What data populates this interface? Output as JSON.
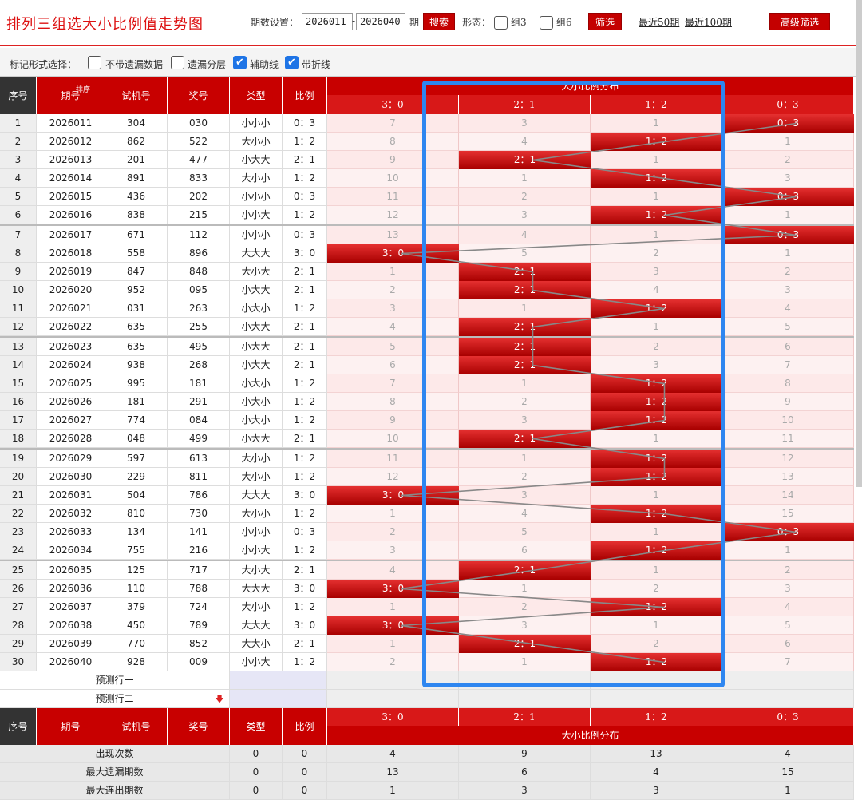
{
  "title": "排列三组选大小比例值走势图",
  "period_setting_label": "期数设置：",
  "period_from": "2026011",
  "period_to": "2026040",
  "period_suffix": "期",
  "search_label": "搜索",
  "shape_label": "形态：",
  "group3_label": "组3",
  "group6_label": "组6",
  "filter_label": "筛选",
  "recent50_label": "最近50期",
  "recent100_label": "最近100期",
  "advanced_filter_label": "高级筛选",
  "mark_label": "标记形式选择：",
  "mark_options": [
    {
      "label": "不带遗漏数据",
      "checked": false
    },
    {
      "label": "遗漏分层",
      "checked": false
    },
    {
      "label": "辅助线",
      "checked": true
    },
    {
      "label": "带折线",
      "checked": true
    }
  ],
  "columns": {
    "seq": "序号",
    "period": "期号",
    "sort_label": "排序",
    "test": "试机号",
    "draw": "奖号",
    "type": "类型",
    "ratio": "比例",
    "dist_title": "大小比例分布",
    "dist": [
      "3：0",
      "2：1",
      "1：2",
      "0：3"
    ]
  },
  "rows": [
    {
      "seq": "1",
      "period": "2026011",
      "test": "304",
      "draw": "030",
      "type": "小小小",
      "ratio": "0：3",
      "hit": 3,
      "miss": [
        "7",
        "3",
        "1",
        ""
      ]
    },
    {
      "seq": "2",
      "period": "2026012",
      "test": "862",
      "draw": "522",
      "type": "大小小",
      "ratio": "1：2",
      "hit": 2,
      "miss": [
        "8",
        "4",
        "",
        "1"
      ]
    },
    {
      "seq": "3",
      "period": "2026013",
      "test": "201",
      "draw": "477",
      "type": "小大大",
      "ratio": "2：1",
      "hit": 1,
      "miss": [
        "9",
        "",
        "1",
        "2"
      ]
    },
    {
      "seq": "4",
      "period": "2026014",
      "test": "891",
      "draw": "833",
      "type": "大小小",
      "ratio": "1：2",
      "hit": 2,
      "miss": [
        "10",
        "1",
        "",
        "3"
      ]
    },
    {
      "seq": "5",
      "period": "2026015",
      "test": "436",
      "draw": "202",
      "type": "小小小",
      "ratio": "0：3",
      "hit": 3,
      "miss": [
        "11",
        "2",
        "1",
        ""
      ]
    },
    {
      "seq": "6",
      "period": "2026016",
      "test": "838",
      "draw": "215",
      "type": "小小大",
      "ratio": "1：2",
      "hit": 2,
      "miss": [
        "12",
        "3",
        "",
        "1"
      ]
    },
    {
      "seq": "7",
      "period": "2026017",
      "test": "671",
      "draw": "112",
      "type": "小小小",
      "ratio": "0：3",
      "hit": 3,
      "miss": [
        "13",
        "4",
        "1",
        ""
      ]
    },
    {
      "seq": "8",
      "period": "2026018",
      "test": "558",
      "draw": "896",
      "type": "大大大",
      "ratio": "3：0",
      "hit": 0,
      "miss": [
        "",
        "5",
        "2",
        "1"
      ]
    },
    {
      "seq": "9",
      "period": "2026019",
      "test": "847",
      "draw": "848",
      "type": "大小大",
      "ratio": "2：1",
      "hit": 1,
      "miss": [
        "1",
        "",
        "3",
        "2"
      ]
    },
    {
      "seq": "10",
      "period": "2026020",
      "test": "952",
      "draw": "095",
      "type": "小大大",
      "ratio": "2：1",
      "hit": 1,
      "miss": [
        "2",
        "",
        "4",
        "3"
      ]
    },
    {
      "seq": "11",
      "period": "2026021",
      "test": "031",
      "draw": "263",
      "type": "小大小",
      "ratio": "1：2",
      "hit": 2,
      "miss": [
        "3",
        "1",
        "",
        "4"
      ]
    },
    {
      "seq": "12",
      "period": "2026022",
      "test": "635",
      "draw": "255",
      "type": "小大大",
      "ratio": "2：1",
      "hit": 1,
      "miss": [
        "4",
        "",
        "1",
        "5"
      ]
    },
    {
      "seq": "13",
      "period": "2026023",
      "test": "635",
      "draw": "495",
      "type": "小大大",
      "ratio": "2：1",
      "hit": 1,
      "miss": [
        "5",
        "",
        "2",
        "6"
      ]
    },
    {
      "seq": "14",
      "period": "2026024",
      "test": "938",
      "draw": "268",
      "type": "小大大",
      "ratio": "2：1",
      "hit": 1,
      "miss": [
        "6",
        "",
        "3",
        "7"
      ]
    },
    {
      "seq": "15",
      "period": "2026025",
      "test": "995",
      "draw": "181",
      "type": "小大小",
      "ratio": "1：2",
      "hit": 2,
      "miss": [
        "7",
        "1",
        "",
        "8"
      ]
    },
    {
      "seq": "16",
      "period": "2026026",
      "test": "181",
      "draw": "291",
      "type": "小大小",
      "ratio": "1：2",
      "hit": 2,
      "miss": [
        "8",
        "2",
        "",
        "9"
      ]
    },
    {
      "seq": "17",
      "period": "2026027",
      "test": "774",
      "draw": "084",
      "type": "小大小",
      "ratio": "1：2",
      "hit": 2,
      "miss": [
        "9",
        "3",
        "",
        "10"
      ]
    },
    {
      "seq": "18",
      "period": "2026028",
      "test": "048",
      "draw": "499",
      "type": "小大大",
      "ratio": "2：1",
      "hit": 1,
      "miss": [
        "10",
        "",
        "1",
        "11"
      ]
    },
    {
      "seq": "19",
      "period": "2026029",
      "test": "597",
      "draw": "613",
      "type": "大小小",
      "ratio": "1：2",
      "hit": 2,
      "miss": [
        "11",
        "1",
        "",
        "12"
      ]
    },
    {
      "seq": "20",
      "period": "2026030",
      "test": "229",
      "draw": "811",
      "type": "大小小",
      "ratio": "1：2",
      "hit": 2,
      "miss": [
        "12",
        "2",
        "",
        "13"
      ]
    },
    {
      "seq": "21",
      "period": "2026031",
      "test": "504",
      "draw": "786",
      "type": "大大大",
      "ratio": "3：0",
      "hit": 0,
      "miss": [
        "",
        "3",
        "1",
        "14"
      ]
    },
    {
      "seq": "22",
      "period": "2026032",
      "test": "810",
      "draw": "730",
      "type": "大小小",
      "ratio": "1：2",
      "hit": 2,
      "miss": [
        "1",
        "4",
        "",
        "15"
      ]
    },
    {
      "seq": "23",
      "period": "2026033",
      "test": "134",
      "draw": "141",
      "type": "小小小",
      "ratio": "0：3",
      "hit": 3,
      "miss": [
        "2",
        "5",
        "1",
        ""
      ]
    },
    {
      "seq": "24",
      "period": "2026034",
      "test": "755",
      "draw": "216",
      "type": "小小大",
      "ratio": "1：2",
      "hit": 2,
      "miss": [
        "3",
        "6",
        "",
        "1"
      ]
    },
    {
      "seq": "25",
      "period": "2026035",
      "test": "125",
      "draw": "717",
      "type": "大小大",
      "ratio": "2：1",
      "hit": 1,
      "miss": [
        "4",
        "",
        "1",
        "2"
      ]
    },
    {
      "seq": "26",
      "period": "2026036",
      "test": "110",
      "draw": "788",
      "type": "大大大",
      "ratio": "3：0",
      "hit": 0,
      "miss": [
        "",
        "1",
        "2",
        "3"
      ]
    },
    {
      "seq": "27",
      "period": "2026037",
      "test": "379",
      "draw": "724",
      "type": "大小小",
      "ratio": "1：2",
      "hit": 2,
      "miss": [
        "1",
        "2",
        "",
        "4"
      ]
    },
    {
      "seq": "28",
      "period": "2026038",
      "test": "450",
      "draw": "789",
      "type": "大大大",
      "ratio": "3：0",
      "hit": 0,
      "miss": [
        "",
        "3",
        "1",
        "5"
      ]
    },
    {
      "seq": "29",
      "period": "2026039",
      "test": "770",
      "draw": "852",
      "type": "大大小",
      "ratio": "2：1",
      "hit": 1,
      "miss": [
        "1",
        "",
        "2",
        "6"
      ]
    },
    {
      "seq": "30",
      "period": "2026040",
      "test": "928",
      "draw": "009",
      "type": "小小大",
      "ratio": "1：2",
      "hit": 2,
      "miss": [
        "2",
        "1",
        "",
        "7"
      ]
    }
  ],
  "predict_rows": [
    "预测行一",
    "预测行二"
  ],
  "stats": [
    {
      "label": "出现次数",
      "type": "0",
      "ratio": "0",
      "vals": [
        "4",
        "9",
        "13",
        "4"
      ]
    },
    {
      "label": "最大遗漏期数",
      "type": "0",
      "ratio": "0",
      "vals": [
        "13",
        "6",
        "4",
        "15"
      ]
    },
    {
      "label": "最大连出期数",
      "type": "0",
      "ratio": "0",
      "vals": [
        "1",
        "3",
        "3",
        "1"
      ]
    }
  ],
  "colors": {
    "brand_red": "#c80000",
    "highlight_blue": "#2e86f0"
  }
}
